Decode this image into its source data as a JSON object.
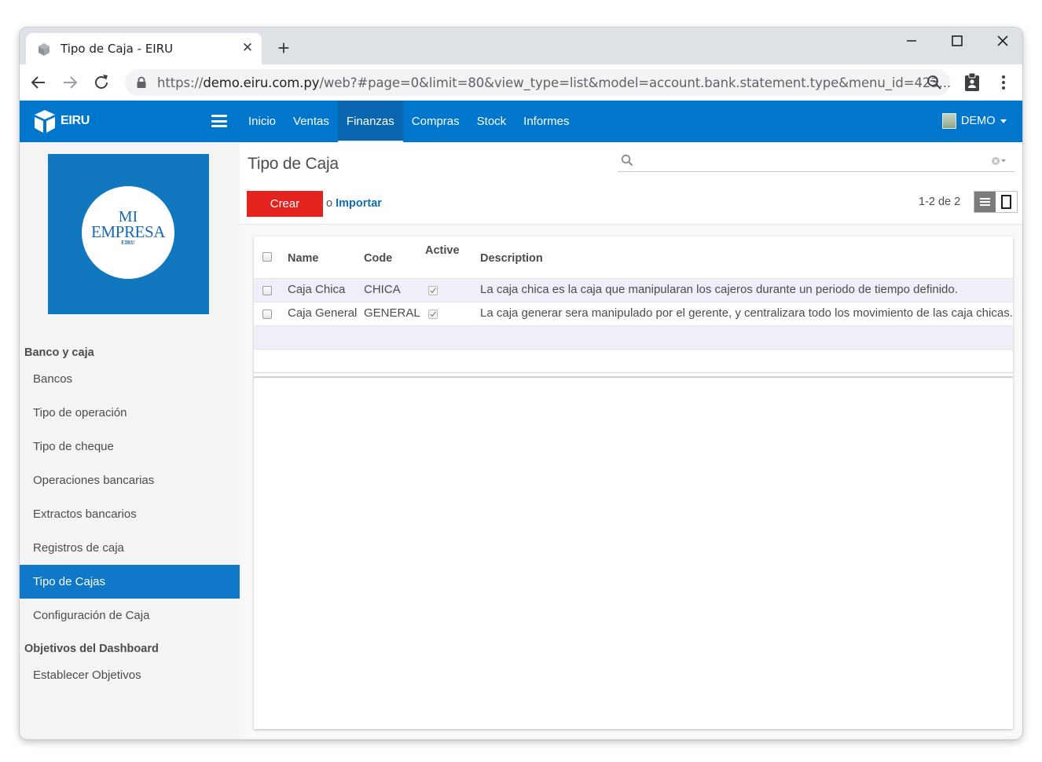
{
  "browser": {
    "tab_title": "Tipo de Caja - EIRU",
    "url_scheme": "https://",
    "url_host": "demo.eiru.com.py",
    "url_path": "/web?#page=0&limit=80&view_type=list&model=account.bank.statement.type&menu_id=423..."
  },
  "app": {
    "brand": "EIRU",
    "brand_color": "#0077cc",
    "menu": [
      "Inicio",
      "Ventas",
      "Finanzas",
      "Compras",
      "Stock",
      "Informes"
    ],
    "active_menu": "Finanzas",
    "user": "DEMO"
  },
  "sidebar": {
    "logo": {
      "line1": "MI",
      "line2": "EMPRESA",
      "line3": "EIRU"
    },
    "sections": [
      {
        "title": "Banco y caja",
        "items": [
          "Bancos",
          "Tipo de operación",
          "Tipo de cheque",
          "Operaciones bancarias",
          "Extractos bancarios",
          "Registros de caja",
          "Tipo de Cajas",
          "Configuración de Caja"
        ]
      },
      {
        "title": "Objetivos del Dashboard",
        "items": [
          "Establecer Objetivos"
        ]
      }
    ],
    "active_item": "Tipo de Cajas"
  },
  "control_panel": {
    "title": "Tipo de Caja",
    "search_placeholder": "",
    "create_label": "Crear",
    "import_prefix": "o",
    "import_label": "Importar",
    "pager": "1-2 de 2",
    "create_color": "#e5231e"
  },
  "table": {
    "headers": [
      "Name",
      "Code",
      "Active",
      "Description"
    ],
    "rows": [
      {
        "name": "Caja Chica",
        "code": "CHICA",
        "active": true,
        "description": "La caja chica es la caja que manipularan los cajeros durante un periodo de tiempo definido."
      },
      {
        "name": "Caja General",
        "code": "GENERAL",
        "active": true,
        "description": "La caja generar sera manipulado por el gerente, y centralizara todo los movimiento de las caja chicas."
      }
    ]
  }
}
